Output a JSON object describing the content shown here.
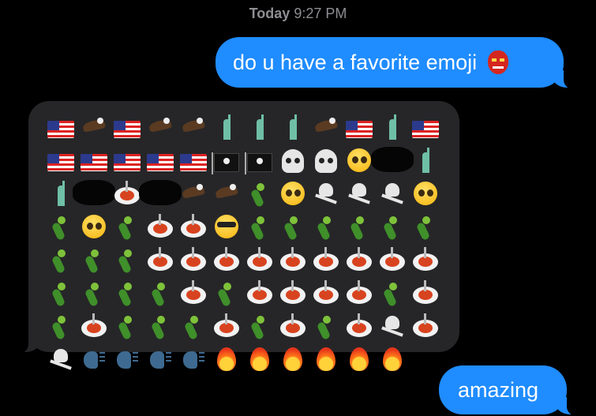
{
  "timestamp": {
    "day": "Today",
    "time": "9:27 PM"
  },
  "messages": {
    "first": {
      "text": "do u have a favorite emoji",
      "emoji": "japanese-goblin-icon"
    },
    "reply_emoji_grid": [
      [
        "flag-us",
        "eagle",
        "flag-us",
        "eagle",
        "eagle",
        "statue-of-liberty",
        "statue-of-liberty",
        "statue-of-liberty",
        "eagle",
        "flag-us",
        "statue-of-liberty",
        "flag-us"
      ],
      [
        "flag-us",
        "flag-us",
        "flag-us",
        "flag-us",
        "flag-us",
        "pirate-flag",
        "pirate-flag",
        "skull",
        "skull",
        "pleading-face",
        "redacted",
        "statue-of-liberty"
      ],
      [
        "statue-of-liberty",
        "redacted",
        "spaghetti",
        "redacted",
        "eagle",
        "eagle",
        "parrot",
        "pleading-face",
        "skull-crossbones",
        "skull-crossbones",
        "skull-crossbones",
        "pleading-face"
      ],
      [
        "parrot",
        "pleading-face",
        "parrot",
        "spaghetti",
        "spaghetti",
        "sunglasses-face",
        "parrot",
        "parrot",
        "parrot",
        "parrot",
        "parrot",
        "parrot"
      ],
      [
        "parrot",
        "parrot",
        "parrot",
        "spaghetti",
        "spaghetti",
        "spaghetti",
        "spaghetti",
        "spaghetti",
        "spaghetti",
        "spaghetti",
        "spaghetti",
        "spaghetti"
      ],
      [
        "parrot",
        "parrot",
        "parrot",
        "parrot",
        "spaghetti",
        "parrot",
        "spaghetti",
        "spaghetti",
        "spaghetti",
        "spaghetti",
        "parrot",
        "spaghetti"
      ],
      [
        "parrot",
        "spaghetti",
        "parrot",
        "parrot",
        "parrot",
        "spaghetti",
        "parrot",
        "spaghetti",
        "parrot",
        "spaghetti",
        "skull-crossbones",
        "spaghetti"
      ],
      [
        "skull-crossbones",
        "speaking-head",
        "speaking-head",
        "speaking-head",
        "speaking-head",
        "fire",
        "fire",
        "fire",
        "fire",
        "fire",
        "fire"
      ]
    ],
    "last": {
      "text": "amazing"
    }
  },
  "colors": {
    "outgoing": "#1f8cff",
    "incoming": "#262628",
    "background": "#000000"
  }
}
